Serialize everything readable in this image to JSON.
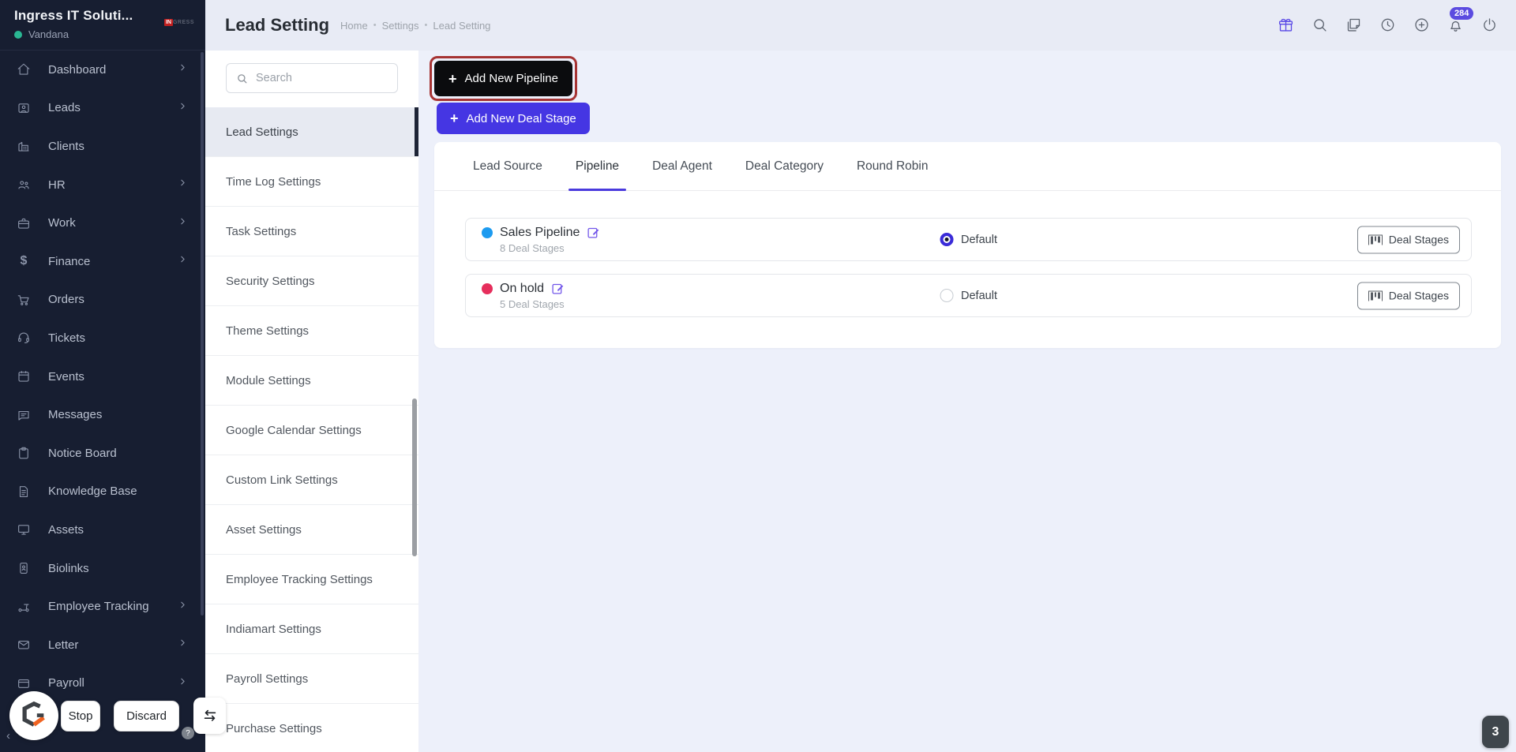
{
  "app": {
    "company_name": "Ingress IT Soluti...",
    "user_name": "Vandana",
    "logo_in": "IN",
    "logo_rest": "GRESS"
  },
  "sidebar": {
    "items": [
      {
        "label": "Dashboard",
        "icon": "home-icon",
        "has_submenu": true
      },
      {
        "label": "Leads",
        "icon": "person-card-icon",
        "has_submenu": true
      },
      {
        "label": "Clients",
        "icon": "building-icon",
        "has_submenu": false
      },
      {
        "label": "HR",
        "icon": "people-icon",
        "has_submenu": true
      },
      {
        "label": "Work",
        "icon": "briefcase-icon",
        "has_submenu": true
      },
      {
        "label": "Finance",
        "icon": "dollar-icon",
        "has_submenu": true
      },
      {
        "label": "Orders",
        "icon": "cart-icon",
        "has_submenu": false
      },
      {
        "label": "Tickets",
        "icon": "headset-icon",
        "has_submenu": false
      },
      {
        "label": "Events",
        "icon": "calendar-icon",
        "has_submenu": false
      },
      {
        "label": "Messages",
        "icon": "chat-icon",
        "has_submenu": false
      },
      {
        "label": "Notice Board",
        "icon": "clipboard-icon",
        "has_submenu": false
      },
      {
        "label": "Knowledge Base",
        "icon": "document-icon",
        "has_submenu": false
      },
      {
        "label": "Assets",
        "icon": "monitor-icon",
        "has_submenu": false
      },
      {
        "label": "Biolinks",
        "icon": "id-badge-icon",
        "has_submenu": false
      },
      {
        "label": "Employee Tracking",
        "icon": "scooter-icon",
        "has_submenu": true
      },
      {
        "label": "Letter",
        "icon": "envelope-icon",
        "has_submenu": true
      },
      {
        "label": "Payroll",
        "icon": "wallet-icon",
        "has_submenu": true
      }
    ]
  },
  "settings_nav": {
    "search_placeholder": "Search",
    "active_item": "Lead Settings",
    "items": [
      "Lead Settings",
      "Time Log Settings",
      "Task Settings",
      "Security Settings",
      "Theme Settings",
      "Module Settings",
      "Google Calendar Settings",
      "Custom Link Settings",
      "Asset Settings",
      "Employee Tracking Settings",
      "Indiamart Settings",
      "Payroll Settings",
      "Purchase Settings"
    ]
  },
  "header": {
    "title": "Lead Setting",
    "breadcrumb": [
      "Home",
      "Settings",
      "Lead Setting"
    ],
    "separator": "•",
    "notification_count": "284"
  },
  "actions": {
    "add_pipeline": "Add New Pipeline",
    "add_deal_stage": "Add New Deal Stage",
    "plus": "+"
  },
  "tabs": {
    "active": "Pipeline",
    "items": [
      {
        "label": "Lead Source"
      },
      {
        "label": "Pipeline"
      },
      {
        "label": "Deal Agent"
      },
      {
        "label": "Deal Category"
      },
      {
        "label": "Round Robin"
      }
    ]
  },
  "pipelines": {
    "rows": [
      {
        "name": "Sales Pipeline",
        "stage_count": "8 Deal Stages",
        "dot_color": "#1d9bf0",
        "default_label": "Default",
        "is_default": true,
        "deal_stages_button": "Deal Stages"
      },
      {
        "name": "On hold",
        "stage_count": "5 Deal Stages",
        "dot_color": "#e62e5c",
        "default_label": "Default",
        "is_default": false,
        "deal_stages_button": "Deal Stages"
      }
    ]
  },
  "agent_bar": {
    "stop": "Stop",
    "discard": "Discard",
    "help": "?",
    "page_badge": "3"
  },
  "colors": {
    "accent_purple": "#4536e3",
    "tab_underline": "#4a3add",
    "highlight_ring": "#a63434",
    "badge_purple": "#5b4be0",
    "sidebar_bg": "#171e31",
    "online_green": "#2ab793"
  }
}
